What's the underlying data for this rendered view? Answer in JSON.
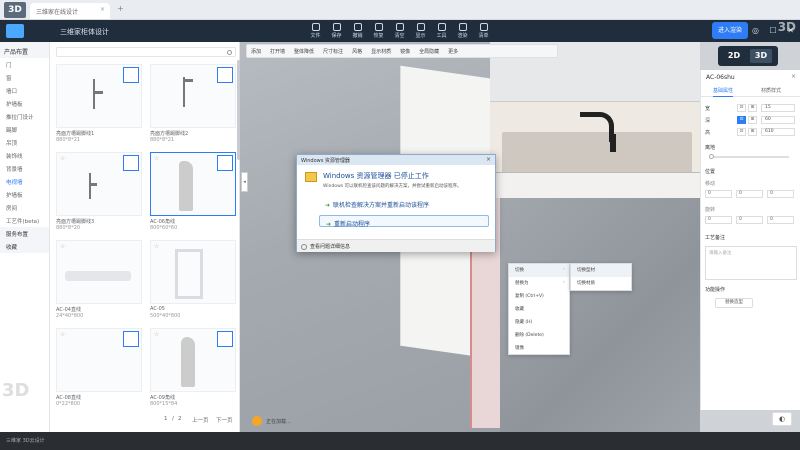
{
  "browser": {
    "tab_title": "三维家在线设计",
    "tab_close": "×",
    "new_tab": "+",
    "brand_watermark": "3D"
  },
  "header": {
    "app_title": "三维家柜体设计",
    "toolbar": [
      "文件",
      "保存",
      "撤销",
      "恢复",
      "清空",
      "显示",
      "工具",
      "渲染",
      "清单"
    ],
    "cta": "进入渲染",
    "icons": "◎ ☐ ✕",
    "watermark": "3D"
  },
  "left_nav": {
    "head": "产品布置",
    "items": [
      "门",
      "窗",
      "墙口",
      "护墙板",
      "推拉门设计",
      "踢脚",
      "吊顶",
      "装饰线",
      "背景墙",
      "电视墙",
      "护墙板",
      "房间",
      "工艺件(beta)"
    ],
    "active_index": 9,
    "sections": [
      "服务布置",
      "收藏"
    ]
  },
  "catalog": {
    "items": [
      {
        "name": "亮面方槽踢脚线1",
        "size": "880*8*21"
      },
      {
        "name": "亮面方槽踢脚线2",
        "size": "880*8*21"
      },
      {
        "name": "亮面方槽踢脚线3",
        "size": "880*8*20"
      },
      {
        "name": "AC-06角线",
        "size": "800*60*60"
      },
      {
        "name": "AC-04直线",
        "size": "24*40*800"
      },
      {
        "name": "AC-05",
        "size": "500*40*800"
      },
      {
        "name": "AC-08直线",
        "size": "0*22*800"
      },
      {
        "name": "AC-09角线",
        "size": "800*15*84"
      }
    ],
    "pager": {
      "prev": "上一页",
      "next": "下一页",
      "current": "1",
      "total": "2"
    }
  },
  "viewport": {
    "toolbar": [
      "添加",
      "打开墙",
      "整体降低",
      "尺寸标注",
      "风格",
      "显示材质",
      "镜像",
      "全局隐藏",
      "更多"
    ],
    "left_handle": "◂",
    "status": "正在加载..."
  },
  "dialog": {
    "title": "Windows 资源管理器",
    "close": "×",
    "heading": "Windows 资源管理器 已停止工作",
    "body": "Windows 可以联机检查该问题的解决方案，并尝试重新启动该程序。",
    "option1": "联机检查解决方案并重新启动该程序",
    "option2": "重新启动程序",
    "footer": "查看问题详细信息"
  },
  "context_menu": {
    "items": [
      "切换",
      "替换为",
      "复制 (Ctrl+V)",
      "收藏",
      "隐藏 (H)",
      "删除 (Delete)",
      "镜像"
    ],
    "submenu": [
      "切换型材",
      "切换材质"
    ]
  },
  "right_panel": {
    "title": "AC-06shu",
    "close": "×",
    "tabs": [
      "基础属性",
      "材质样式"
    ],
    "dims": [
      {
        "label": "宽",
        "value": "15"
      },
      {
        "label": "深",
        "value": "60"
      },
      {
        "label": "高",
        "value": "610"
      }
    ],
    "slider_label": "离地",
    "position_label": "位置",
    "position_fields": [
      "移动",
      "旋转"
    ],
    "xyz": [
      "0",
      "0",
      "0"
    ],
    "process_label": "工艺备注",
    "textarea_placeholder": "请输入备注",
    "function_label": "功能操作",
    "button": "替换造型"
  },
  "view_switch": {
    "two_d": "2D",
    "three_d": "3D",
    "active": "3D"
  },
  "bottom": {
    "text": "三维家 3D云设计",
    "corner": "◐",
    "watermark_bl": "3D"
  }
}
